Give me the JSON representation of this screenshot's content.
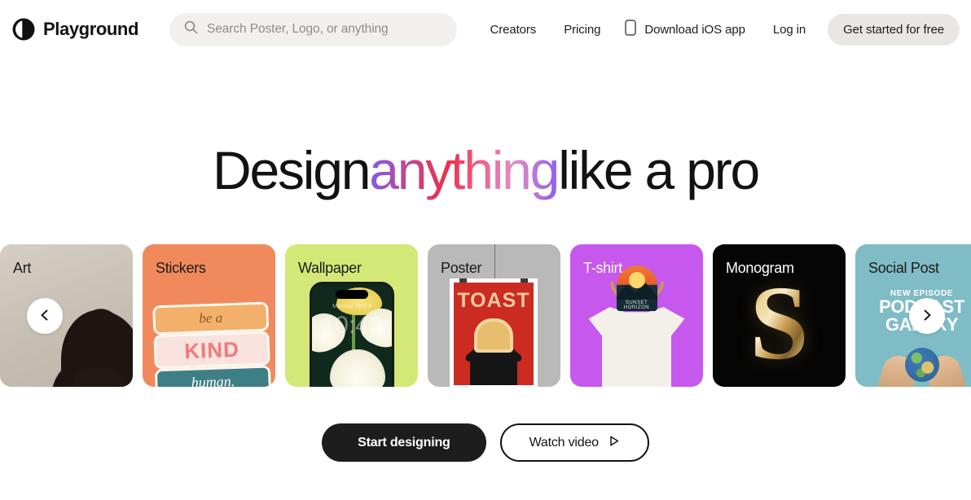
{
  "brand": {
    "name": "Playground",
    "logo_icon": "playground-logo-icon"
  },
  "search": {
    "placeholder": "Search Poster, Logo, or anything",
    "value": "",
    "icon": "search-icon"
  },
  "nav": {
    "links": [
      {
        "label": "Creators"
      },
      {
        "label": "Pricing"
      },
      {
        "label": "Download iOS app",
        "icon": "phone-icon"
      },
      {
        "label": "Log in"
      }
    ],
    "cta": {
      "label": "Get started for free",
      "bg": "#e8e7e3"
    }
  },
  "hero": {
    "headline_part1": "Design",
    "headline_gradient": "anything",
    "headline_part2": "like a pro",
    "gradient_colors": [
      "#7b5cf5",
      "#ee2f4c",
      "#e48bc4",
      "#8a5df2"
    ]
  },
  "carousel": {
    "prev_icon": "chevron-left-icon",
    "next_icon": "chevron-right-icon",
    "cards": [
      {
        "label": "Art",
        "bg": "#cdc6bc",
        "label_color": "#1b1b1b"
      },
      {
        "label": "Stickers",
        "bg": "#f08a5d",
        "label_color": "#1b1b1b"
      },
      {
        "label": "Wallpaper",
        "bg": "#d4e878",
        "label_color": "#1b1b1b"
      },
      {
        "label": "Poster",
        "bg": "#b9b9b9",
        "label_color": "#1b1b1b"
      },
      {
        "label": "T-shirt",
        "bg": "#c758ee",
        "label_color": "#ffffff"
      },
      {
        "label": "Monogram",
        "bg": "#050505",
        "label_color": "#ffffff"
      },
      {
        "label": "Social Post",
        "bg": "#7fbcc5",
        "label_color": "#1b1b1b"
      }
    ]
  },
  "artwork": {
    "stickers": {
      "line1": "be a",
      "line2": "KIND",
      "line3": "human."
    },
    "wallpaper": {
      "time": "10:42",
      "date": "Monday, April 8"
    },
    "poster": {
      "title": "TOAST"
    },
    "tshirt": {
      "caption": "SUNSET HORIZON"
    },
    "monogram": {
      "letter": "S"
    },
    "social": {
      "line1": "NEW EPISODE",
      "line2": "PODCAST",
      "line3": "GALAXY"
    }
  },
  "actions": {
    "primary": {
      "label": "Start designing"
    },
    "secondary": {
      "label": "Watch video",
      "icon": "play-icon"
    }
  }
}
